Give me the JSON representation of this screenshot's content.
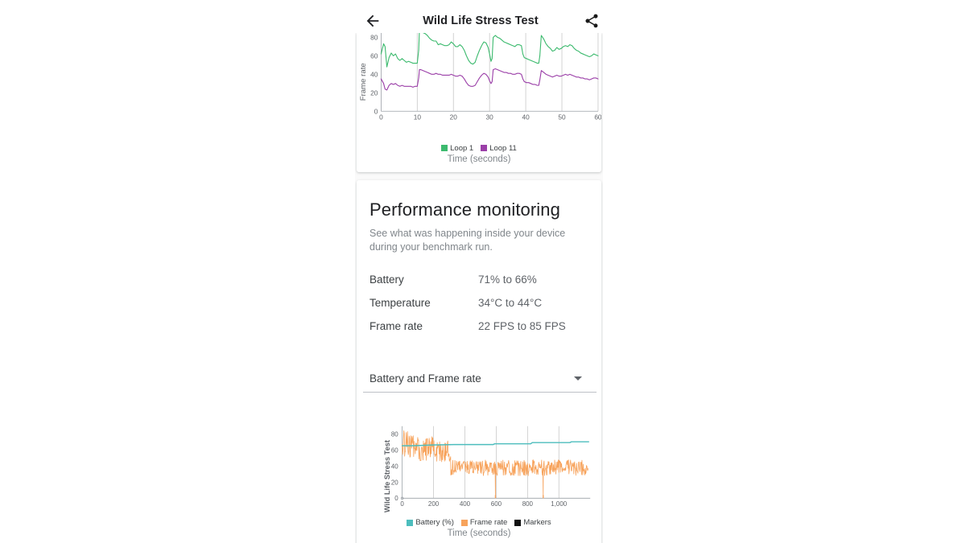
{
  "appbar": {
    "back_icon": "arrow-left-icon",
    "title": "Wild Life Stress Test",
    "share_icon": "share-icon"
  },
  "theme": {
    "page_bg": "#ffffff",
    "content_bg": "#fafafa",
    "card_bg": "#ffffff",
    "text_primary": "#202124",
    "text_secondary": "#5f6368",
    "text_muted": "#80868b",
    "loop1_color": "#3cba6e",
    "loop11_color": "#9b3fa8",
    "battery_color": "#4dbdbd",
    "framerate_color": "#f7a35c",
    "markers_color": "#101010"
  },
  "performance_monitoring": {
    "title": "Performance monitoring",
    "subtitle": "See what was happening inside your device during your benchmark run.",
    "stats": [
      {
        "label": "Battery",
        "value": "71% to 66%"
      },
      {
        "label": "Temperature",
        "value": "34°C to 44°C"
      },
      {
        "label": "Frame rate",
        "value": "22 FPS to 85 FPS"
      }
    ],
    "selector": {
      "value": "Battery and Frame rate",
      "caret_icon": "chevron-down-icon"
    }
  },
  "chart_data": [
    {
      "id": "frame-rate-loops-chart",
      "type": "line",
      "title": "",
      "xlabel": "Time (seconds)",
      "ylabel": "Frame rate",
      "xlim": [
        0,
        60
      ],
      "ylim": [
        0,
        90
      ],
      "xticks": [
        0,
        10,
        20,
        30,
        40,
        50,
        60
      ],
      "yticks": [
        0,
        20,
        40,
        60,
        80
      ],
      "grid": true,
      "legend_position": "bottom",
      "clipped_top": true,
      "series": [
        {
          "name": "Loop 1",
          "color": "#3cba6e",
          "x": [
            0,
            0.7,
            1.1,
            1.6,
            2.2,
            2.8,
            3.4,
            4.0,
            4.6,
            5.2,
            5.8,
            6.4,
            7.0,
            7.6,
            8.2,
            8.8,
            9.4,
            10.0,
            10.4,
            10.6,
            11.0,
            11.6,
            12.2,
            12.8,
            13.4,
            14.0,
            14.6,
            15.2,
            15.8,
            16.4,
            17.0,
            17.6,
            18.2,
            18.8,
            19.4,
            20.0,
            20.6,
            21.2,
            21.8,
            22.4,
            23.0,
            23.6,
            24.2,
            24.8,
            25.4,
            26.0,
            26.6,
            27.2,
            27.8,
            28.4,
            29.0,
            29.6,
            30.0,
            30.4,
            30.7,
            31.0,
            31.6,
            32.2,
            32.8,
            33.4,
            34.0,
            34.6,
            35.2,
            35.8,
            36.4,
            37.0,
            37.6,
            38.2,
            38.8,
            39.2,
            39.6,
            40.2,
            40.8,
            41.4,
            42.0,
            42.6,
            43.2,
            43.6,
            43.9,
            44.3,
            45.0,
            45.6,
            46.2,
            46.8,
            47.4,
            48.0,
            48.6,
            49.2,
            49.8,
            50.4,
            51.0,
            51.6,
            52.2,
            52.8,
            53.4,
            54.0,
            54.6,
            55.2,
            55.8,
            56.4,
            57.0,
            57.6,
            58.2,
            58.8,
            59.4,
            60.0
          ],
          "y": [
            62,
            73,
            70,
            48,
            58,
            63,
            60,
            62,
            57,
            55,
            57,
            55,
            53,
            54,
            53,
            52,
            52,
            52,
            66,
            88,
            87,
            85,
            84,
            82,
            79,
            77,
            76,
            76,
            72,
            73,
            72,
            71,
            71,
            72,
            75,
            73,
            70,
            70,
            72,
            70,
            66,
            60,
            55,
            52,
            51,
            53,
            60,
            66,
            71,
            75,
            74,
            69,
            62,
            54,
            57,
            80,
            82,
            80,
            79,
            77,
            75,
            74,
            73,
            72,
            71,
            70,
            72,
            72,
            71,
            62,
            58,
            57,
            56,
            55,
            54,
            53,
            52,
            52,
            60,
            82,
            78,
            73,
            70,
            68,
            65,
            66,
            69,
            67,
            68,
            70,
            71,
            70,
            72,
            71,
            68,
            66,
            65,
            63,
            62,
            61,
            60,
            59,
            60,
            62,
            61,
            60
          ]
        },
        {
          "name": "Loop 11",
          "color": "#9b3fa8",
          "x": [
            0,
            0.7,
            1.1,
            1.6,
            2.2,
            2.8,
            3.4,
            4.0,
            4.6,
            5.2,
            5.8,
            6.4,
            7.0,
            7.6,
            8.2,
            8.8,
            9.4,
            10.0,
            10.4,
            10.6,
            11.0,
            11.6,
            12.2,
            12.8,
            13.4,
            14.0,
            14.6,
            15.2,
            15.8,
            16.4,
            17.0,
            17.6,
            18.2,
            18.8,
            19.4,
            20.0,
            20.6,
            21.2,
            21.8,
            22.4,
            23.0,
            23.6,
            24.2,
            24.8,
            25.4,
            26.0,
            26.6,
            27.2,
            27.8,
            28.4,
            29.0,
            29.6,
            30.0,
            30.4,
            30.7,
            31.0,
            31.6,
            32.2,
            32.8,
            33.4,
            34.0,
            34.6,
            35.2,
            35.8,
            36.4,
            37.0,
            37.6,
            38.2,
            38.8,
            39.2,
            39.6,
            40.2,
            40.8,
            41.4,
            42.0,
            42.6,
            43.2,
            43.6,
            43.9,
            44.3,
            45.0,
            45.6,
            46.2,
            46.8,
            47.4,
            48.0,
            48.6,
            49.2,
            49.8,
            50.4,
            51.0,
            51.6,
            52.2,
            52.8,
            53.4,
            54.0,
            54.6,
            55.2,
            55.8,
            56.4,
            57.0,
            57.6,
            58.2,
            58.8,
            59.4,
            60.0
          ],
          "y": [
            35,
            30,
            24,
            23,
            28,
            30,
            29,
            30,
            28,
            27,
            28,
            27,
            27,
            27,
            27,
            26,
            27,
            27,
            36,
            45,
            45,
            44,
            43,
            42,
            41,
            40,
            40,
            41,
            40,
            40,
            39,
            39,
            39,
            39,
            40,
            39,
            38,
            38,
            39,
            38,
            35,
            31,
            28,
            27,
            27,
            28,
            32,
            36,
            39,
            41,
            40,
            37,
            33,
            30,
            32,
            45,
            46,
            45,
            44,
            43,
            42,
            42,
            41,
            41,
            40,
            40,
            41,
            41,
            40,
            35,
            32,
            31,
            31,
            30,
            29,
            29,
            28,
            28,
            34,
            44,
            42,
            40,
            39,
            38,
            37,
            38,
            39,
            38,
            38,
            39,
            40,
            39,
            40,
            39,
            38,
            37,
            37,
            36,
            36,
            35,
            35,
            34,
            35,
            36,
            36,
            35
          ]
        }
      ]
    },
    {
      "id": "battery-framerate-chart",
      "type": "line",
      "title": "",
      "xlabel": "Time (seconds)",
      "ylabel": "Wild Life Stress Test",
      "xlim": [
        0,
        1200
      ],
      "ylim": [
        0,
        90
      ],
      "xticks": [
        0,
        200,
        400,
        600,
        800,
        1000
      ],
      "xticklabels": [
        "0",
        "200",
        "400",
        "600",
        "800",
        "1,000"
      ],
      "yticks": [
        0,
        20,
        40,
        60,
        80
      ],
      "grid": true,
      "legend_position": "bottom",
      "legend": [
        "Battery (%)",
        "Frame rate",
        "Markers"
      ],
      "series": [
        {
          "name": "Battery (%)",
          "color": "#4dbdbd",
          "x": [
            0,
            60,
            200,
            330,
            580,
            590,
            820,
            830,
            1070,
            1080,
            1190
          ],
          "y": [
            65.5,
            65.5,
            66.5,
            67,
            67,
            68,
            68,
            69.5,
            69.5,
            70.5,
            70.5
          ]
        },
        {
          "name": "Frame rate",
          "color": "#f7a35c",
          "noise": true,
          "segments": [
            {
              "x_start": 0,
              "x_end": 60,
              "mean": 68,
              "amp": 18
            },
            {
              "x_start": 60,
              "x_end": 200,
              "mean": 62,
              "amp": 16
            },
            {
              "x_start": 200,
              "x_end": 310,
              "mean": 58,
              "amp": 14
            },
            {
              "x_start": 310,
              "x_end": 1190,
              "mean": 38,
              "amp": 10
            }
          ]
        },
        {
          "name": "Markers",
          "color": "#101010",
          "marker_x": [
            595,
            900
          ]
        }
      ]
    }
  ]
}
